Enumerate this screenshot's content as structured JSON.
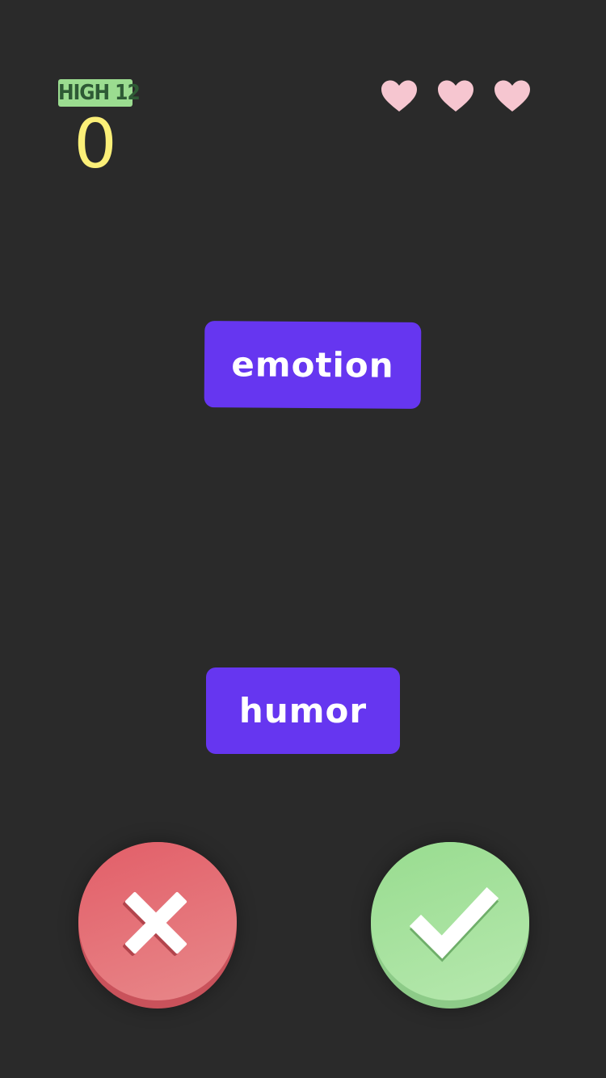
{
  "hud": {
    "high_label": "HIGH 12",
    "score": "0",
    "lives_remaining": 3,
    "heart_color": "#f6c6d0"
  },
  "cards": {
    "top_word": "emotion",
    "bottom_word": "humor",
    "card_color": "#6636f0"
  },
  "controls": {
    "reject_icon": "close-icon",
    "accept_icon": "checkmark-icon",
    "reject_color": "#e25e68",
    "accept_color": "#98dc8f"
  }
}
